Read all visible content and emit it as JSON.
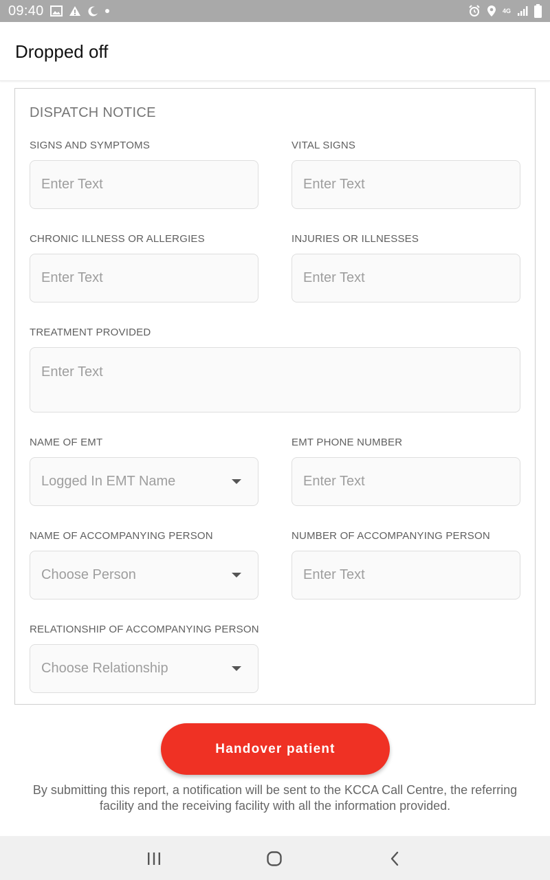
{
  "status_bar": {
    "time": "09:40",
    "left_icons": [
      "image-icon",
      "warning-icon",
      "moon-icon",
      "dot-icon"
    ],
    "right_icons": [
      "alarm-icon",
      "location-icon",
      "network-4g-icon",
      "signal-icon",
      "battery-icon"
    ],
    "network_label": "4G"
  },
  "app_bar": {
    "title": "Dropped off"
  },
  "form": {
    "section_title": "DISPATCH NOTICE",
    "fields": {
      "signs_symptoms": {
        "label": "SIGNS AND SYMPTOMS",
        "placeholder": "Enter Text"
      },
      "vital_signs": {
        "label": "VITAL SIGNS",
        "placeholder": "Enter Text"
      },
      "chronic_illness": {
        "label": "CHRONIC ILLNESS OR ALLERGIES",
        "placeholder": "Enter Text"
      },
      "injuries": {
        "label": "INJURIES OR ILLNESSES",
        "placeholder": "Enter Text"
      },
      "treatment": {
        "label": "TREATMENT PROVIDED",
        "placeholder": "Enter Text"
      },
      "emt_name": {
        "label": "NAME OF EMT",
        "value": "Logged In EMT Name"
      },
      "emt_phone": {
        "label": "EMT PHONE NUMBER",
        "placeholder": "Enter Text"
      },
      "accompanying_name": {
        "label": "NAME OF ACCOMPANYING PERSON",
        "value": "Choose Person"
      },
      "accompanying_number": {
        "label": "NUMBER OF ACCOMPANYING PERSON",
        "placeholder": "Enter Text"
      },
      "relationship": {
        "label": "RELATIONSHIP OF ACCOMPANYING PERSON",
        "value": "Choose Relationship"
      }
    }
  },
  "submit": {
    "label": "Handover patient",
    "color": "#ef3124",
    "disclaimer": "By submitting this report, a notification will be sent to the KCCA Call Centre, the referring facility and the receiving facility with all the information provided."
  },
  "nav_bar": {
    "icons": [
      "recent-apps-icon",
      "home-icon",
      "back-icon"
    ]
  }
}
